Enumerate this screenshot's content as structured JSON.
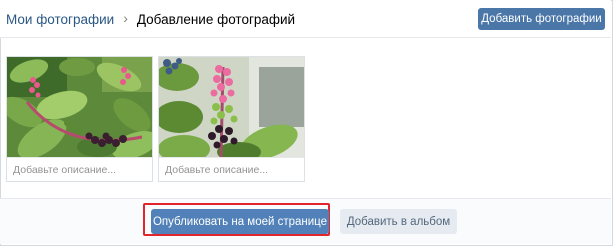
{
  "header": {
    "breadcrumb_root": "Мои фотографии",
    "breadcrumb_separator": "›",
    "breadcrumb_current": "Добавление фотографий",
    "add_photos_label": "Добавить фотографии"
  },
  "photos": [
    {
      "description_placeholder": "Добавьте описание..."
    },
    {
      "description_placeholder": "Добавьте описание..."
    }
  ],
  "footer": {
    "publish_label": "Опубликовать на моей странице",
    "add_to_album_label": "Добавить в альбом"
  },
  "colors": {
    "primary_button": "#5181b8",
    "secondary_button": "#e5ebf1",
    "highlight_frame": "#e0262a",
    "link": "#2a5885"
  }
}
